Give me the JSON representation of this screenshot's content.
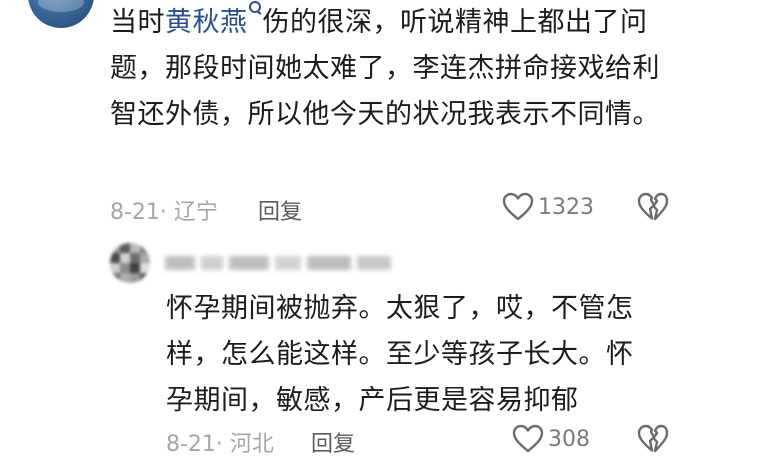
{
  "main_comment": {
    "text_before": "当时",
    "mention": "黄秋燕",
    "text_after": "伤的很深，听说精神上都出了问题，那段时间她太难了，李连杰拼命接戏给利智还外债，所以他今天的状况我表示不同情。",
    "time_location": "8-21· 辽宁",
    "reply_label": "回复",
    "like_count": "1323"
  },
  "reply_comment": {
    "text": "怀孕期间被抛弃。太狠了，哎，不管怎样，怎么能这样。至少等孩子长大。怀孕期间，敏感，产后更是容易抑郁",
    "time_location": "8-21· 河北",
    "reply_label": "回复",
    "like_count": "308"
  },
  "colors": {
    "mention": "#2b4f8a",
    "meta_gray": "#a6a6a6",
    "icon_gray": "#6b6b6b"
  },
  "icons": {
    "like": "heart-icon",
    "dislike": "broken-heart-icon",
    "mention": "search-icon"
  }
}
